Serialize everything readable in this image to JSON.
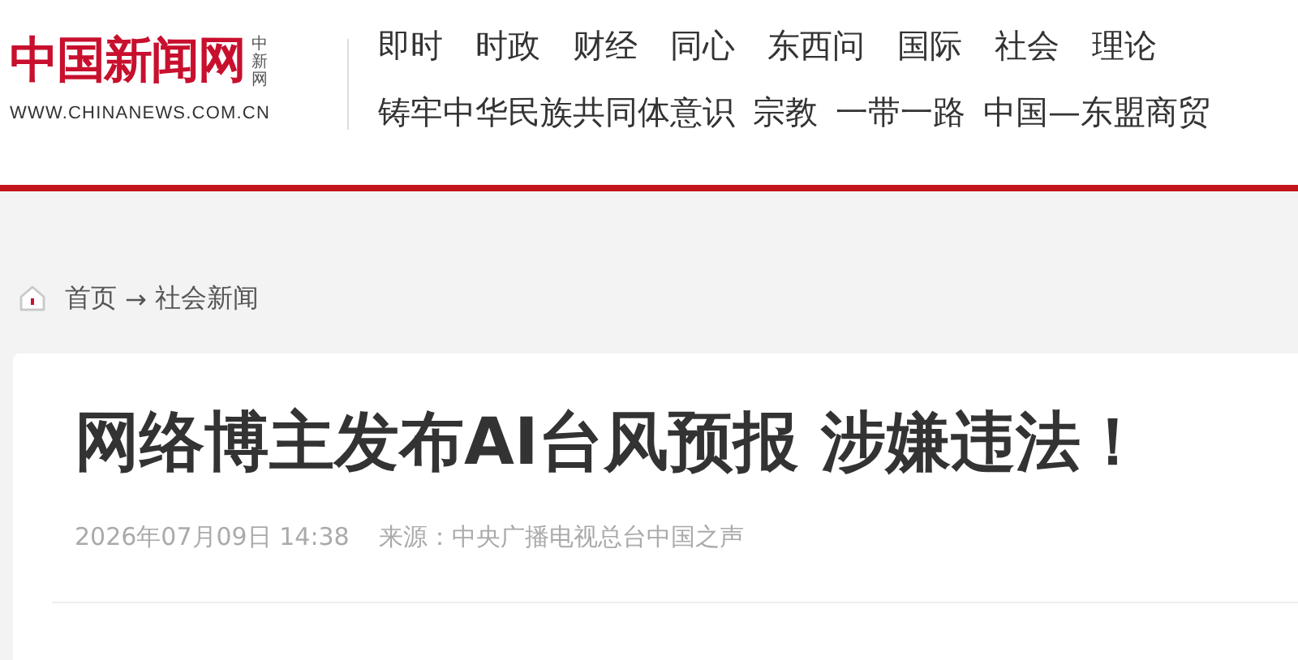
{
  "logo": {
    "name": "中国新闻网",
    "short": "中新网",
    "url": "WWW.CHINANEWS.COM.CN"
  },
  "nav_primary": [
    "即时",
    "时政",
    "财经",
    "同心",
    "东西问",
    "国际",
    "社会",
    "理论"
  ],
  "nav_secondary": [
    "铸牢中华民族共同体意识",
    "宗教",
    "一带一路",
    "中国—东盟商贸"
  ],
  "breadcrumb": {
    "home": "首页",
    "separator": "→",
    "current": "社会新闻"
  },
  "article": {
    "title": "网络博主发布AI台风预报 涉嫌违法！",
    "date": "2026年07月09日 14:38",
    "source": "来源：中央广播电视总台中国之声"
  }
}
